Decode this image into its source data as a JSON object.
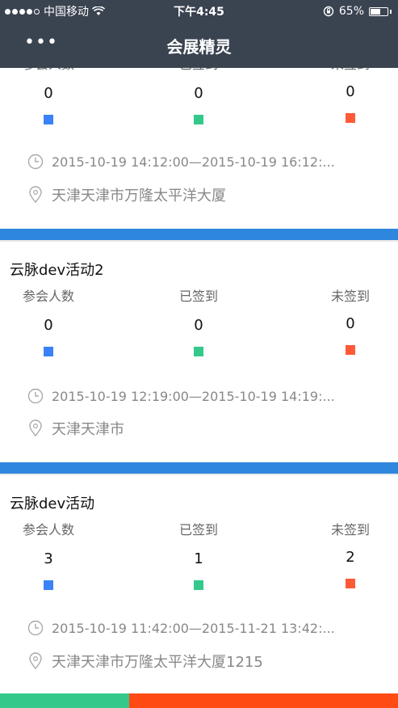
{
  "status_bar": {
    "carrier": "中国移动",
    "time": "下午4:45",
    "battery_pct": "65%",
    "battery_level": 0.65
  },
  "nav": {
    "title": "会展精灵",
    "more_label": "•••"
  },
  "colors": {
    "header_bg": "#3a4350",
    "divider_blue": "#2f86dd",
    "total_color": "#3b82f6",
    "checked_color": "#34c98b",
    "unchecked_color": "#ff5a36",
    "bottom_green": "#34c98b",
    "bottom_red": "#ff4a14"
  },
  "labels": {
    "total": "参会人数",
    "checked": "已签到",
    "unchecked": "未签到"
  },
  "events": [
    {
      "title": "",
      "total": "0",
      "checked": "0",
      "unchecked": "0",
      "time": "2015-10-19 14:12:00—2015-10-19 16:12:...",
      "location": "天津天津市万隆太平洋大厦"
    },
    {
      "title": "云脉dev活动2",
      "total": "0",
      "checked": "0",
      "unchecked": "0",
      "time": "2015-10-19 12:19:00—2015-10-19 14:19:...",
      "location": "天津天津市"
    },
    {
      "title": "云脉dev活动",
      "total": "3",
      "checked": "1",
      "unchecked": "2",
      "time": "2015-10-19 11:42:00—2015-11-21 13:42:...",
      "location": "天津天津市万隆太平洋大厦1215"
    }
  ],
  "bottom_bar": {
    "green_fraction": 0.325
  }
}
